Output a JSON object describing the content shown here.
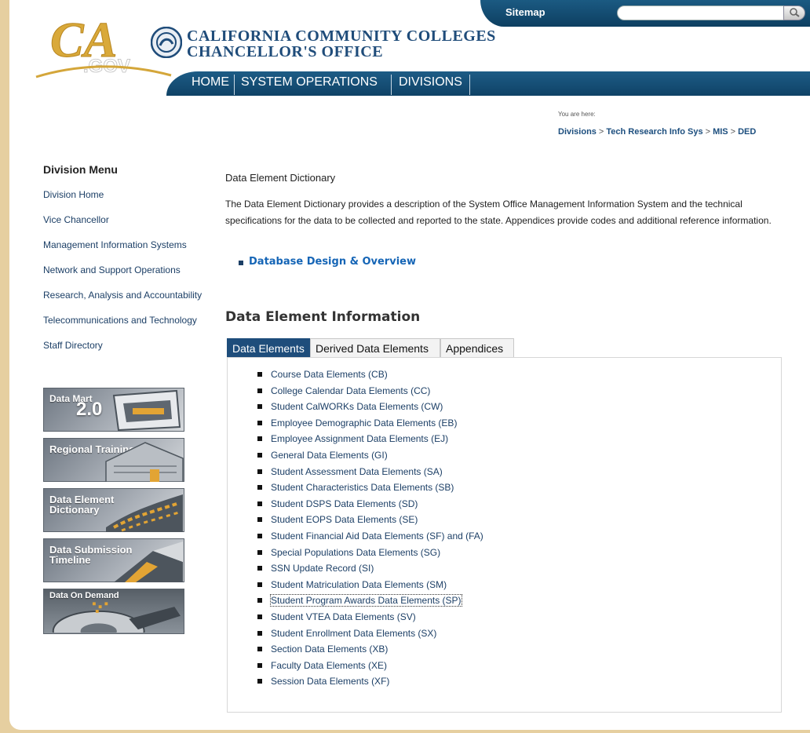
{
  "header": {
    "sitemap_label": "Sitemap",
    "search_placeholder": "",
    "logo_text": "CA.GOV",
    "org_line1": "CALIFORNIA COMMUNITY COLLEGES",
    "org_line2": "CHANCELLOR'S OFFICE",
    "nav": [
      "HOME",
      "SYSTEM OPERATIONS",
      "DIVISIONS"
    ],
    "colors": {
      "nav_blue": "#0f4266",
      "gold": "#d4a63a",
      "title_blue": "#1f4c7a"
    }
  },
  "breadcrumb": {
    "you_are_here": "You are here:",
    "items": [
      "Divisions",
      "Tech Research Info Sys",
      "MIS",
      "DED"
    ],
    "separator": ">"
  },
  "sidebar": {
    "title": "Division Menu",
    "items": [
      "Division Home",
      "Vice Chancellor",
      "Management Information Systems",
      "Network and Support Operations",
      "Research, Analysis and Accountability",
      "Telecommunications and Technology",
      "Staff Directory"
    ],
    "tiles": [
      {
        "label": "Data Mart",
        "extra": "2.0",
        "icon": "data-mart-icon"
      },
      {
        "label": "Regional Training",
        "icon": "school-building-icon"
      },
      {
        "label": "Data Element Dictionary",
        "icon": "dictionary-icon"
      },
      {
        "label": "Data Submission Timeline",
        "icon": "timeline-icon"
      },
      {
        "label": "Data On Demand",
        "icon": "hard-drive-icon"
      }
    ]
  },
  "main": {
    "heading": "Data Element Dictionary",
    "intro": "The Data Element Dictionary provides a description of the System Office Management Information System and the technical specifications for the data to be collected and reported to the state. Appendices provide codes and additional reference information.",
    "design_link": "Database Design & Overview",
    "info_heading": "Data Element Information",
    "tabs": [
      "Data Elements",
      "Derived Data Elements",
      "Appendices"
    ],
    "active_tab": "Data Elements",
    "elements": [
      "Course Data Elements (CB)",
      "College Calendar Data Elements (CC)",
      "Student CalWORKs Data Elements (CW)",
      "Employee Demographic Data Elements (EB)",
      "Employee Assignment Data Elements (EJ)",
      "General Data Elements (GI)",
      "Student Assessment Data Elements (SA)",
      "Student Characteristics Data Elements (SB)",
      "Student DSPS Data Elements (SD)",
      "Student EOPS Data Elements (SE)",
      "Student Financial Aid Data Elements (SF) and (FA)",
      "Special Populations Data Elements (SG)",
      "SSN Update Record (SI)",
      "Student Matriculation Data Elements (SM)",
      "Student Program Awards Data Elements (SP)",
      "Student VTEA Data Elements (SV)",
      "Student Enrollment Data Elements (SX)",
      "Section Data Elements (XB)",
      "Faculty Data Elements (XE)",
      "Session Data Elements (XF)"
    ]
  }
}
